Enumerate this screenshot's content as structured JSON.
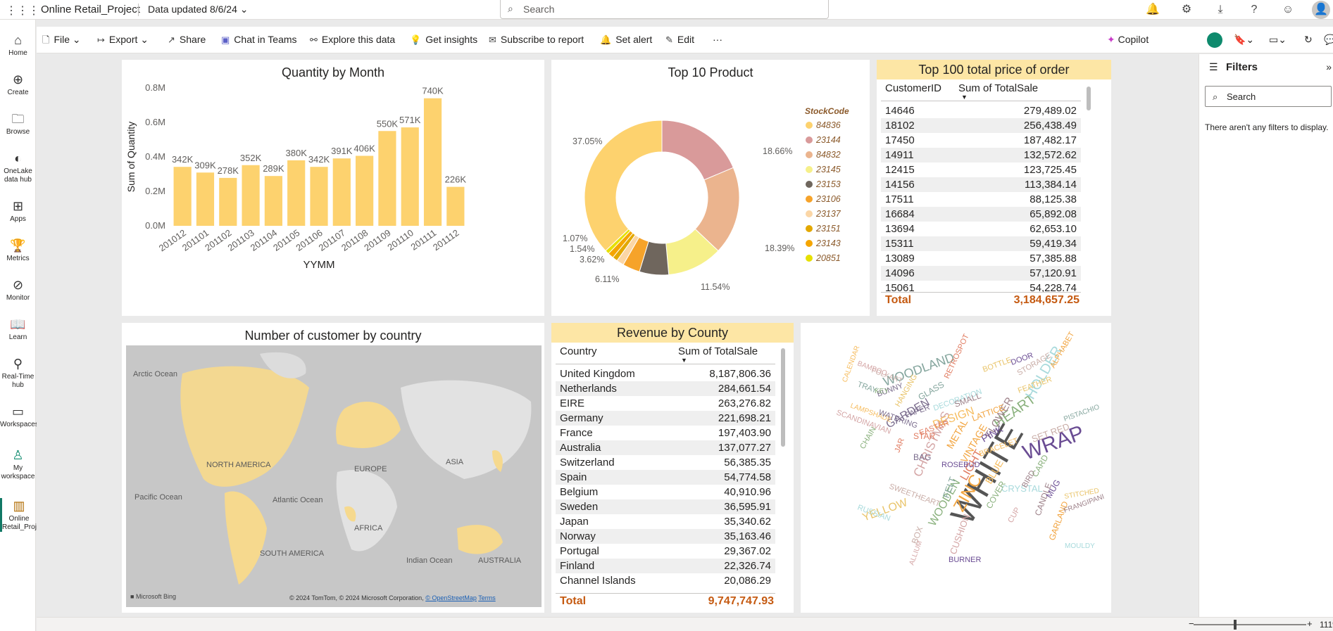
{
  "header": {
    "app_title": "Online Retail_Project",
    "data_updated": "Data updated 8/6/24",
    "search_placeholder": "Search",
    "avatar": "👤"
  },
  "toolbar": {
    "file": "File",
    "export": "Export",
    "share": "Share",
    "chat_in_teams": "Chat in Teams",
    "explore": "Explore this data",
    "get_insights": "Get insights",
    "subscribe": "Subscribe to report",
    "set_alert": "Set alert",
    "edit": "Edit",
    "more": "···",
    "copilot": "Copilot"
  },
  "nav": [
    {
      "label": "Home",
      "icon": "home-icon"
    },
    {
      "label": "Create",
      "icon": "plus-icon"
    },
    {
      "label": "Browse",
      "icon": "folder-icon"
    },
    {
      "label": "OneLake data hub",
      "icon": "onelake-icon"
    },
    {
      "label": "Apps",
      "icon": "apps-icon"
    },
    {
      "label": "Metrics",
      "icon": "trophy-icon"
    },
    {
      "label": "Monitor",
      "icon": "monitor-icon"
    },
    {
      "label": "Learn",
      "icon": "book-icon"
    },
    {
      "label": "Real-Time hub",
      "icon": "realtime-icon"
    },
    {
      "label": "Workspaces",
      "icon": "workspaces-icon"
    },
    {
      "label": "My workspace",
      "icon": "person-icon"
    },
    {
      "label": "Online Retail_Proj...",
      "icon": "report-icon"
    }
  ],
  "quantity_chart": {
    "title": "Quantity by Month",
    "xlabel": "YYMM",
    "ylabel": "Sum of Quantity",
    "yticks": [
      "0.0M",
      "0.2M",
      "0.4M",
      "0.6M",
      "0.8M"
    ]
  },
  "donut_chart": {
    "title": "Top 10 Product",
    "legend_title": "StockCode",
    "labels": [
      "37.05%",
      "18.66%",
      "18.39%",
      "11.54%",
      "6.11%",
      "3.62%",
      "1.54%",
      "1.07%"
    ]
  },
  "top100": {
    "title": "Top 100 total price of order",
    "col1": "CustomerID",
    "col2": "Sum of TotalSale",
    "rows": [
      [
        "14646",
        "279,489.02"
      ],
      [
        "18102",
        "256,438.49"
      ],
      [
        "17450",
        "187,482.17"
      ],
      [
        "14911",
        "132,572.62"
      ],
      [
        "12415",
        "123,725.45"
      ],
      [
        "14156",
        "113,384.14"
      ],
      [
        "17511",
        "88,125.38"
      ],
      [
        "16684",
        "65,892.08"
      ],
      [
        "13694",
        "62,653.10"
      ],
      [
        "15311",
        "59,419.34"
      ],
      [
        "13089",
        "57,385.88"
      ],
      [
        "14096",
        "57,120.91"
      ],
      [
        "15061",
        "54,228.74"
      ]
    ],
    "total_label": "Total",
    "total_value": "3,184,657.25"
  },
  "map": {
    "title": "Number of customer by country",
    "labels": [
      "Arctic Ocean",
      "NORTH AMERICA",
      "EUROPE",
      "ASIA",
      "Pacific Ocean",
      "Atlantic Ocean",
      "AFRICA",
      "SOUTH AMERICA",
      "Indian Ocean",
      "AUSTRALIA"
    ],
    "brand": "Microsoft Bing",
    "attribution": "© 2024 TomTom, © 2024 Microsoft Corporation,",
    "osm": "© OpenStreetMap",
    "terms": "Terms"
  },
  "revenue": {
    "title": "Revenue by County",
    "col1": "Country",
    "col2": "Sum of TotalSale",
    "rows": [
      [
        "United Kingdom",
        "8,187,806.36"
      ],
      [
        "Netherlands",
        "284,661.54"
      ],
      [
        "EIRE",
        "263,276.82"
      ],
      [
        "Germany",
        "221,698.21"
      ],
      [
        "France",
        "197,403.90"
      ],
      [
        "Australia",
        "137,077.27"
      ],
      [
        "Switzerland",
        "56,385.35"
      ],
      [
        "Spain",
        "54,774.58"
      ],
      [
        "Belgium",
        "40,910.96"
      ],
      [
        "Sweden",
        "36,595.91"
      ],
      [
        "Japan",
        "35,340.62"
      ],
      [
        "Norway",
        "35,163.46"
      ],
      [
        "Portugal",
        "29,367.02"
      ],
      [
        "Finland",
        "22,326.74"
      ],
      [
        "Channel Islands",
        "20,086.29"
      ]
    ],
    "total_label": "Total",
    "total_value": "9,747,747.93"
  },
  "wordcloud": {
    "words": [
      "WHITE",
      "WRAP",
      "ZINC",
      "HEART",
      "CHRISTMAS",
      "DESIGN",
      "WOODLAND",
      "HOLDER",
      "FLOWER",
      "YELLOW",
      "GARDEN",
      "SET RED",
      "PINK",
      "LIGHT",
      "METAL",
      "WOODEN",
      "CUSHION",
      "BRACELET",
      "GLASS",
      "DECORATION",
      "CANDLE",
      "BOTTLE",
      "BAG",
      "BOX",
      "MUG",
      "STAR",
      "VINTAGE",
      "CARD",
      "CUP",
      "BLUE",
      "FELT",
      "CRYSTAL",
      "BIRD",
      "HANGING",
      "PAPER",
      "STORAGE",
      "DOOR",
      "RETROSPOT",
      "GARLAND",
      "COVER",
      "SCANDINAVIAN",
      "LAMPSHADE",
      "TRAY",
      "RUSSIAN",
      "SMALL",
      "FEATHER",
      "BUNNY",
      "FOLKART",
      "ROSEBUD",
      "JAR",
      "ALPHABET",
      "KEY",
      "BAMBOO",
      "CALENDAR",
      "PISTACHIO",
      "MOULDY",
      "FRANGIPANI",
      "STITCHED",
      "WATERING",
      "SWEETHEART",
      "BURNER",
      "EASTER",
      "LATTICE",
      "CHAIN",
      "ALLIUM"
    ]
  },
  "filters": {
    "title": "Filters",
    "search": "Search",
    "empty": "There aren't any filters to display."
  },
  "status": {
    "zoom": "111%"
  },
  "colors": {
    "bar": "#fdd26e",
    "accent_total": "#c55a11",
    "table_header_bg": "#fde6a5"
  },
  "chart_data": [
    {
      "type": "bar",
      "title": "Quantity by Month",
      "xlabel": "YYMM",
      "ylabel": "Sum of Quantity",
      "categories": [
        "201012",
        "201101",
        "201102",
        "201103",
        "201104",
        "201105",
        "201106",
        "201107",
        "201108",
        "201109",
        "201110",
        "201111",
        "201112"
      ],
      "values": [
        342000,
        309000,
        278000,
        352000,
        289000,
        380000,
        342000,
        391000,
        406000,
        550000,
        571000,
        740000,
        226000
      ],
      "value_labels": [
        "342K",
        "309K",
        "278K",
        "352K",
        "289K",
        "380K",
        "342K",
        "391K",
        "406K",
        "550K",
        "571K",
        "740K",
        "226K"
      ],
      "ylim": [
        0,
        800000
      ],
      "grid": false
    },
    {
      "type": "pie",
      "title": "Top 10 Product",
      "legend_title": "StockCode",
      "categories": [
        "84836",
        "23144",
        "84832",
        "23145",
        "23153",
        "23106",
        "23137",
        "23151",
        "23143",
        "20851"
      ],
      "values": [
        37.05,
        18.66,
        18.39,
        11.54,
        6.11,
        3.62,
        1.54,
        1.07,
        1.2,
        0.82
      ],
      "colors": [
        "#fdd26e",
        "#d99a9a",
        "#ebb48e",
        "#f6f08a",
        "#6f665d",
        "#f6a32a",
        "#fbd6a6",
        "#e3a800",
        "#f5a500",
        "#e6e000"
      ],
      "legend_position": "right"
    }
  ]
}
